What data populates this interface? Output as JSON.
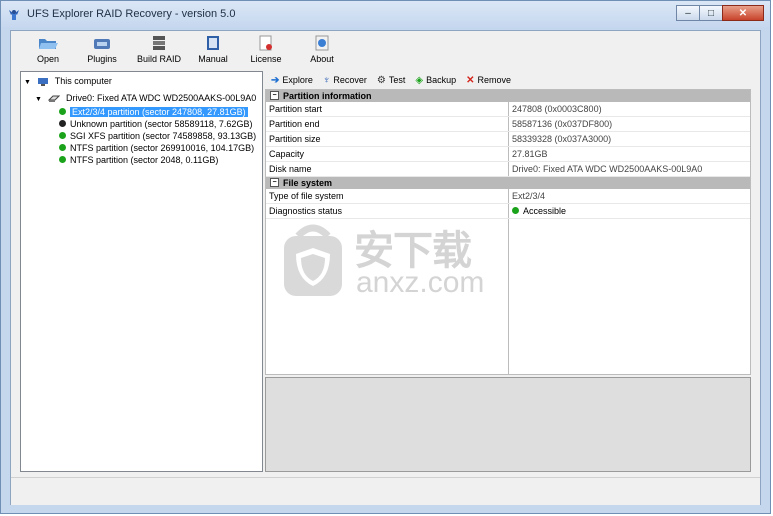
{
  "window": {
    "title": "UFS Explorer RAID Recovery - version 5.0",
    "minimize": "–",
    "maximize": "□",
    "close": "✕"
  },
  "toolbar": {
    "open": "Open",
    "plugins": "Plugins",
    "build_raid": "Build RAID",
    "manual": "Manual",
    "license": "License",
    "about": "About"
  },
  "tree": {
    "root": "This computer",
    "drive": "Drive0: Fixed ATA WDC WD2500AAKS-00L9A0",
    "partitions": [
      {
        "label": "Ext2/3/4 partition (sector 247808, 27.81GB)",
        "status": "green",
        "selected": true
      },
      {
        "label": "Unknown partition (sector 58589118, 7.62GB)",
        "status": "black",
        "selected": false
      },
      {
        "label": "SGI XFS partition (sector 74589858, 93.13GB)",
        "status": "green",
        "selected": false
      },
      {
        "label": "NTFS partition (sector 269910016, 104.17GB)",
        "status": "green",
        "selected": false
      },
      {
        "label": "NTFS partition (sector 2048, 0.11GB)",
        "status": "green",
        "selected": false
      }
    ]
  },
  "actions": {
    "explore": "Explore",
    "recover": "Recover",
    "test": "Test",
    "backup": "Backup",
    "remove": "Remove"
  },
  "properties": {
    "partition_section": "Partition information",
    "partition_rows": [
      {
        "key": "Partition start",
        "value": "247808 (0x0003C800)"
      },
      {
        "key": "Partition end",
        "value": "58587136 (0x037DF800)"
      },
      {
        "key": "Partition size",
        "value": "58339328 (0x037A3000)"
      },
      {
        "key": "Capacity",
        "value": "27.81GB"
      },
      {
        "key": "Disk name",
        "value": "Drive0: Fixed ATA WDC WD2500AAKS-00L9A0"
      }
    ],
    "fs_section": "File system",
    "fs_rows": [
      {
        "key": "Type of file system",
        "value": "Ext2/3/4"
      },
      {
        "key": "Diagnostics status",
        "value": "Accessible"
      }
    ]
  },
  "watermark": {
    "cn": "安下载",
    "en": "anxz.com"
  },
  "colors": {
    "selection": "#3399ff",
    "green": "#1aa31a",
    "section_bg": "#b9b9b9",
    "accent_blue": "#1f6fd1",
    "remove_red": "#d4261d"
  }
}
